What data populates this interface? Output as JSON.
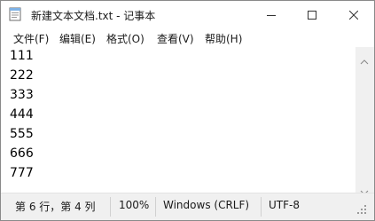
{
  "window": {
    "title": "新建文本文档.txt - 记事本"
  },
  "menu": [
    {
      "label": "文件(F)"
    },
    {
      "label": "编辑(E)"
    },
    {
      "label": "格式(O)"
    },
    {
      "label": "查看(V)"
    },
    {
      "label": "帮助(H)"
    }
  ],
  "editor": {
    "lines": [
      "111",
      "222",
      "333",
      "444",
      "555",
      "666",
      "777"
    ]
  },
  "status": {
    "position": "第 6 行，第 4 列",
    "zoom": "100%",
    "line_ending": "Windows (CRLF)",
    "encoding": "UTF-8"
  },
  "icons": {
    "app": "notepad-icon",
    "minimize": "minimize-icon",
    "maximize": "maximize-icon",
    "close": "close-icon"
  }
}
